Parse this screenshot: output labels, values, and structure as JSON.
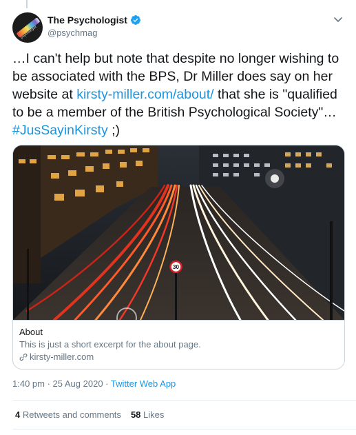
{
  "author": {
    "display_name": "The Psychologist",
    "handle": "@psychmag",
    "avatar_text": "psychologist"
  },
  "tweet": {
    "text_part1": "…I can't help but note that despite no longer wishing to be associated with the BPS, Dr Miller does say on her website at ",
    "link_text": "kirsty-miller.com/about/",
    "text_part2": " that she is \"qualified to be a member of the British Psychological Society\"… ",
    "hashtag": "#JusSayinKirsty",
    "text_part3": " ;)"
  },
  "card": {
    "title": "About",
    "description": "This is just a short excerpt for the about page.",
    "domain": "kirsty-miller.com",
    "speed_sign": "30"
  },
  "meta": {
    "timestamp": "1:40 pm · 25 Aug 2020",
    "separator": " · ",
    "source": "Twitter Web App"
  },
  "stats": {
    "retweets_count": "4",
    "retweets_label": "Retweets and comments",
    "likes_count": "58",
    "likes_label": "Likes"
  },
  "colors": {
    "link": "#1b95e0",
    "verified": "#1da1f2",
    "secondary_text": "#657786"
  },
  "icons": [
    "verified-badge-icon",
    "chevron-down-icon",
    "link-icon"
  ]
}
